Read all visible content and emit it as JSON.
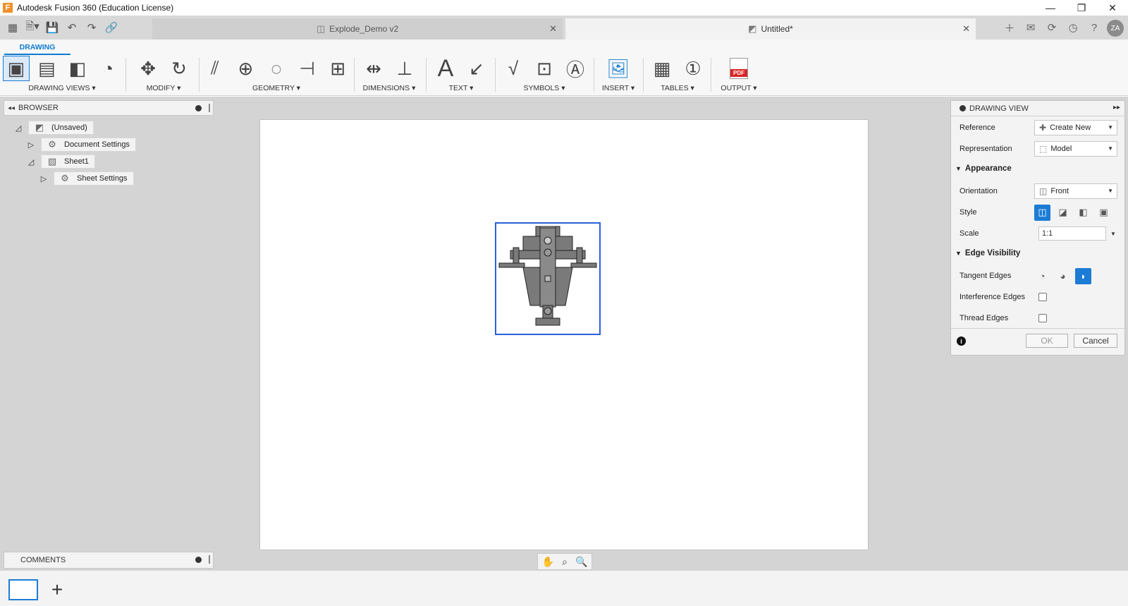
{
  "window": {
    "title": "Autodesk Fusion 360 (Education License)",
    "logo_letter": "F",
    "controls": [
      "—",
      "❐",
      "✕"
    ]
  },
  "tabs": {
    "inactive": {
      "label": "Explode_Demo v2"
    },
    "active": {
      "label": "Untitled*"
    }
  },
  "user": {
    "initials": "ZA"
  },
  "ribbon": {
    "active_tab": "DRAWING",
    "groups": {
      "drawing_views": "DRAWING VIEWS ▾",
      "modify": "MODIFY ▾",
      "geometry": "GEOMETRY ▾",
      "dimensions": "DIMENSIONS ▾",
      "text": "TEXT ▾",
      "symbols": "SYMBOLS ▾",
      "insert": "INSERT ▾",
      "tables": "TABLES ▾",
      "output": "OUTPUT ▾"
    },
    "output_pdf_label": "PDF"
  },
  "browser": {
    "title": "BROWSER",
    "items": {
      "root": "(Unsaved)",
      "document_settings": "Document Settings",
      "sheet1": "Sheet1",
      "sheet_settings": "Sheet Settings"
    }
  },
  "comments": {
    "title": "COMMENTS"
  },
  "dialog": {
    "title": "DRAWING VIEW",
    "reference": {
      "label": "Reference",
      "value": "Create New"
    },
    "representation": {
      "label": "Representation",
      "value": "Model"
    },
    "appearance": {
      "label": "Appearance"
    },
    "orientation": {
      "label": "Orientation",
      "value": "Front"
    },
    "style": {
      "label": "Style",
      "selected_index": 0
    },
    "scale": {
      "label": "Scale",
      "value": "1:1"
    },
    "edge_visibility": {
      "label": "Edge Visibility"
    },
    "tangent_edges": {
      "label": "Tangent Edges",
      "selected_index": 2
    },
    "interference_edges": {
      "label": "Interference Edges",
      "checked": false
    },
    "thread_edges": {
      "label": "Thread Edges",
      "checked": false
    },
    "ok_label": "OK",
    "cancel_label": "Cancel"
  },
  "colors": {
    "accent": "#1c7cd5",
    "view_border": "#2a5fd8",
    "canvas_bg": "#d4d4d4"
  }
}
